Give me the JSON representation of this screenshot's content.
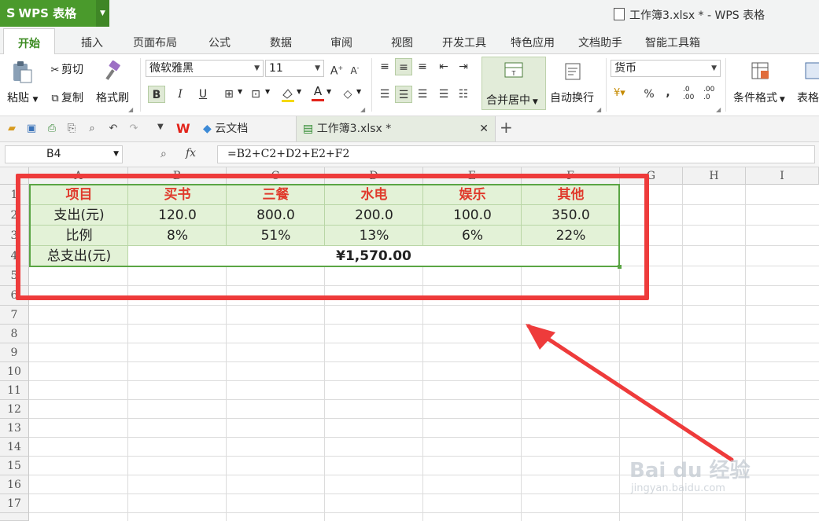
{
  "app": {
    "name": "WPS 表格",
    "logo_letter": "S"
  },
  "window": {
    "title": "工作簿3.xlsx * - WPS 表格"
  },
  "menu_tabs": [
    "开始",
    "插入",
    "页面布局",
    "公式",
    "数据",
    "审阅",
    "视图",
    "开发工具",
    "特色应用",
    "文档助手",
    "智能工具箱"
  ],
  "ribbon": {
    "paste": "粘贴",
    "cut": "剪切",
    "copy": "复制",
    "format_painter": "格式刷",
    "font_name": "微软雅黑",
    "font_size": "11",
    "bold": "B",
    "italic": "I",
    "underline": "U",
    "merge_center": "合并居中",
    "wrap_text": "自动换行",
    "number_format": "货币",
    "percent": "%",
    "comma": ",",
    "inc_decimal": ".0 .00",
    "dec_decimal": ".00 .0",
    "conditional_format": "条件格式",
    "table_style": "表格"
  },
  "doc_tabs": {
    "cloud": "云文档",
    "current": "工作簿3.xlsx *"
  },
  "formula_bar": {
    "cell_ref": "B4",
    "fx": "fx",
    "formula": "=B2+C2+D2+E2+F2"
  },
  "columns": [
    "A",
    "B",
    "C",
    "D",
    "E",
    "F",
    "G",
    "H",
    "I"
  ],
  "rows": [
    "1",
    "2",
    "3",
    "4",
    "5",
    "6",
    "7",
    "8",
    "9",
    "10",
    "11",
    "12",
    "13",
    "14",
    "15",
    "16",
    "17"
  ],
  "table": {
    "header": [
      "项目",
      "买书",
      "三餐",
      "水电",
      "娱乐",
      "其他"
    ],
    "expense_label": "支出(元)",
    "expense": [
      "120.0",
      "800.0",
      "200.0",
      "100.0",
      "350.0"
    ],
    "ratio_label": "比例",
    "ratio": [
      "8%",
      "51%",
      "13%",
      "6%",
      "22%"
    ],
    "total_label": "总支出(元)",
    "total": "¥1,570.00"
  },
  "watermark": {
    "brand": "Bai du 经验",
    "url": "jingyan.baidu.com"
  },
  "colors": {
    "accent": "#4a9a2c",
    "highlight": "#ee3b3b",
    "table_fill": "#e3f2d7",
    "header_text": "#e03a2c"
  }
}
